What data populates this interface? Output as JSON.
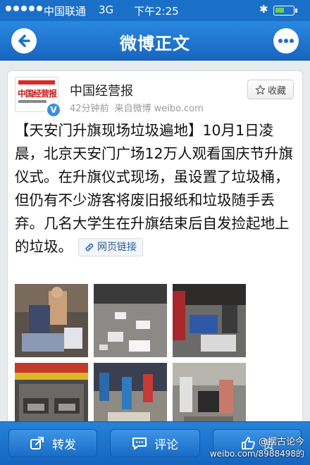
{
  "status_bar": {
    "carrier": "中国联通",
    "network": "3G",
    "time": "下午2:25",
    "battery_level": 0.5
  },
  "nav": {
    "title": "微博正文",
    "back_icon": "back-arrow-icon",
    "more_icon": "more-dots-icon"
  },
  "post": {
    "avatar_label": "中国经营报",
    "author": "中国经营报",
    "time_ago": "42分钟前",
    "source": "来自微博 weibo.com",
    "favorite_label": "收藏",
    "text": "【天安门升旗现场垃圾遍地】10月1日凌晨，北京天安门广场12万人观看国庆节升旗仪式。在升旗仪式现场，虽设置了垃圾桶，但仍有不少游客将废旧报纸和垃圾随手丢弃。几名大学生在升旗结束后自发捡起地上的垃圾。",
    "link_label": "网页链接",
    "photos_count": 6
  },
  "toolbar": {
    "repost_label": "转发",
    "comment_label": "评论",
    "like_label": "赞"
  },
  "watermark": {
    "line1": "@摆古论今",
    "line2": "weibo.com/8988498的"
  },
  "colors": {
    "nav_blue": "#1a70c8",
    "link_blue": "#2a5d99",
    "verified_blue": "#3a8fe0"
  }
}
